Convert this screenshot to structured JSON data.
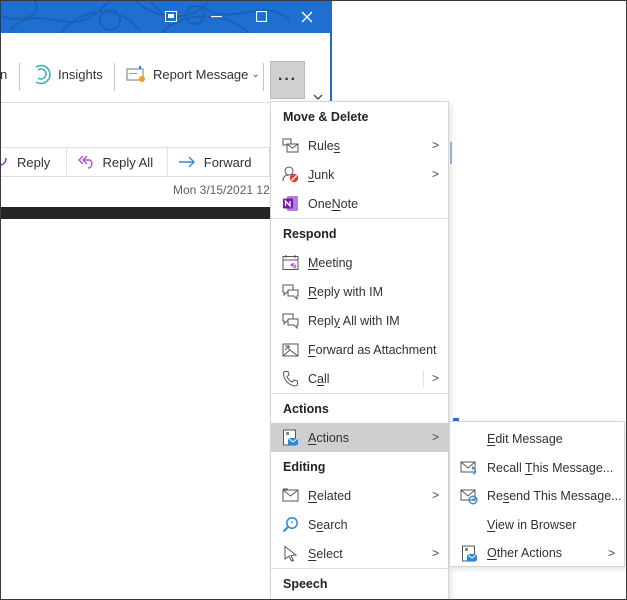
{
  "window": {
    "title_buttons": [
      {
        "name": "restore-window-icon",
        "glyph": "⧉"
      },
      {
        "name": "minimize-icon",
        "glyph": "—"
      },
      {
        "name": "maximize-icon",
        "glyph": "☐"
      },
      {
        "name": "close-icon",
        "glyph": "✕"
      }
    ]
  },
  "ribbon": {
    "partial_label": "n",
    "insights_label": "Insights",
    "report_message_label": "Report Message",
    "report_message_chevron": "⌄",
    "more_label": "···",
    "expand_chevron": "⌄"
  },
  "action_bar": {
    "reply_label": "Reply",
    "reply_all_label": "Reply All",
    "forward_label": "Forward"
  },
  "message": {
    "date": "Mon 3/15/2021 12"
  },
  "menu": {
    "sections": [
      {
        "header": "Move & Delete",
        "items": [
          {
            "label_pre": "Rule",
            "label_u": "s",
            "label_post": "",
            "icon": "rules-icon",
            "submenu": true
          },
          {
            "label_pre": "",
            "label_u": "J",
            "label_post": "unk",
            "icon": "junk-icon",
            "submenu": true
          },
          {
            "label_pre": "One",
            "label_u": "N",
            "label_post": "ote",
            "icon": "onenote-icon",
            "submenu": false
          }
        ]
      },
      {
        "header": "Respond",
        "items": [
          {
            "label_pre": "",
            "label_u": "M",
            "label_post": "eeting",
            "icon": "meeting-icon",
            "submenu": false
          },
          {
            "label_pre": "",
            "label_u": "R",
            "label_post": "eply with IM",
            "icon": "reply-im-icon",
            "submenu": false
          },
          {
            "label_pre": "Repl",
            "label_u": "y",
            "label_post": " All with IM",
            "icon": "reply-all-im-icon",
            "submenu": false
          },
          {
            "label_pre": "",
            "label_u": "F",
            "label_post": "orward as Attachment",
            "icon": "forward-attachment-icon",
            "submenu": false
          },
          {
            "label_pre": "C",
            "label_u": "a",
            "label_post": "ll",
            "icon": "call-icon",
            "submenu": true
          }
        ]
      },
      {
        "header": "Actions",
        "items": [
          {
            "label_pre": "",
            "label_u": "A",
            "label_post": "ctions",
            "icon": "actions-icon",
            "submenu": true,
            "active": true
          }
        ]
      },
      {
        "header": "Editing",
        "items": [
          {
            "label_pre": "",
            "label_u": "R",
            "label_post": "elated",
            "icon": "related-icon",
            "submenu": true
          },
          {
            "label_pre": "S",
            "label_u": "e",
            "label_post": "arch",
            "icon": "search-icon",
            "submenu": false
          },
          {
            "label_pre": "",
            "label_u": "S",
            "label_post": "elect",
            "icon": "select-icon",
            "submenu": true
          }
        ]
      },
      {
        "header": "Speech",
        "items": []
      }
    ]
  },
  "submenu": {
    "items": [
      {
        "label_pre": "",
        "label_u": "E",
        "label_post": "dit Message",
        "icon": null,
        "submenu": false
      },
      {
        "label_pre": "Recall ",
        "label_u": "T",
        "label_post": "his Message...",
        "icon": "recall-message-icon",
        "submenu": false
      },
      {
        "label_pre": "Re",
        "label_u": "s",
        "label_post": "end This Message...",
        "icon": "resend-message-icon",
        "submenu": false
      },
      {
        "label_pre": "",
        "label_u": "V",
        "label_post": "iew in Browser",
        "icon": null,
        "submenu": false
      },
      {
        "label_pre": "",
        "label_u": "O",
        "label_post": "ther Actions",
        "icon": "other-actions-icon",
        "submenu": true
      }
    ]
  },
  "colors": {
    "titlebar": "#1f6fd0",
    "active_item": "#cfcfcf",
    "more_button": "#d2d0ce",
    "accent": "#0078d4"
  }
}
